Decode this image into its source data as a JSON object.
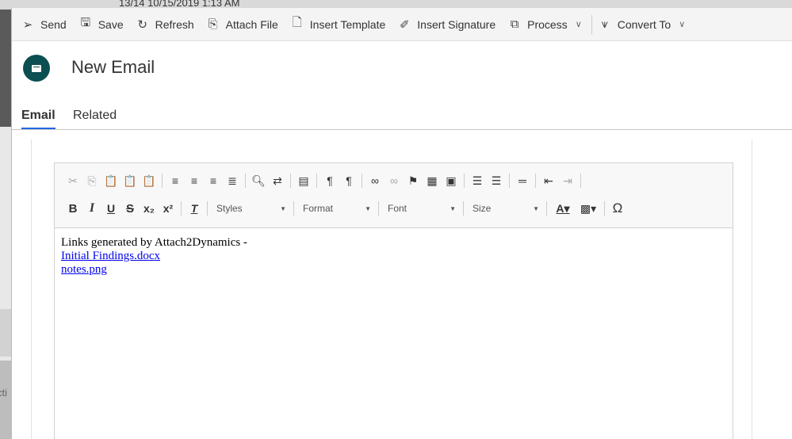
{
  "background": {
    "top_text": "13/14    10/15/2019 1:13 AM",
    "left_text": "cti"
  },
  "commands": [
    {
      "label": "Send",
      "icon": "send-icon"
    },
    {
      "label": "Save",
      "icon": "save-icon"
    },
    {
      "label": "Refresh",
      "icon": "refresh-icon"
    },
    {
      "label": "Attach File",
      "icon": "paperclip-icon"
    },
    {
      "label": "Insert Template",
      "icon": "document-icon"
    },
    {
      "label": "Insert Signature",
      "icon": "signature-icon"
    },
    {
      "label": "Process",
      "icon": "process-icon"
    },
    {
      "label": "Convert To",
      "icon": "convert-icon"
    }
  ],
  "header": {
    "title": "New Email",
    "avatar_color": "#0b4f52"
  },
  "tabs": [
    {
      "label": "Email",
      "active": true
    },
    {
      "label": "Related",
      "active": false
    }
  ],
  "editor": {
    "combos": {
      "styles": "Styles",
      "format": "Format",
      "font": "Font",
      "size": "Size"
    },
    "body_text": "Links generated by Attach2Dynamics -",
    "links": [
      "Initial Findings.docx",
      "notes.png"
    ],
    "link_color": "#0000ee"
  },
  "accent_color": "#2266e3"
}
